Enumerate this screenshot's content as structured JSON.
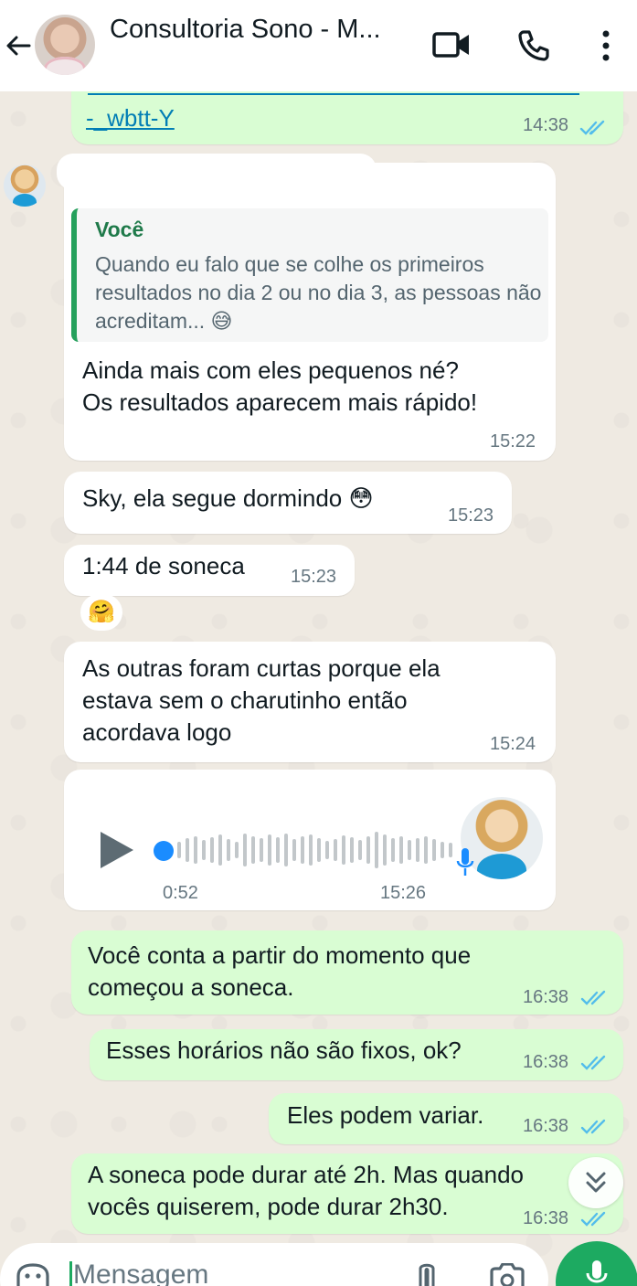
{
  "header": {
    "title": "Consultoria Sono - M...",
    "icons": [
      "back-arrow-icon",
      "video-call-icon",
      "phone-icon",
      "more-vert-icon"
    ]
  },
  "messages": {
    "link_msg": {
      "text": "-_wbtt-Y",
      "time": "14:38"
    },
    "reply_msg": {
      "quote_author": "Você",
      "quote_text": "Quando eu falo que se colhe os primeiros resultados no dia 2 ou no dia 3, as pessoas não acreditam... 😅",
      "line1": "Ainda mais com eles pequenos né?",
      "line2": "Os resultados aparecem mais rápido!",
      "time": "15:22"
    },
    "msg_sky": {
      "text": "Sky, ela segue dormindo 😳",
      "time": "15:23"
    },
    "msg_soneca": {
      "text": "1:44 de soneca",
      "time": "15:23"
    },
    "reaction": "🤗",
    "msg_outras": {
      "line1": "As outras foram curtas porque ela",
      "line2": "estava sem o charutinho então",
      "line3": "acordava logo",
      "time": "15:24"
    },
    "voice": {
      "duration": "0:52",
      "time": "15:26",
      "progress": 0
    },
    "out1": {
      "line1": "Você conta a partir do momento que",
      "line2": "começou a soneca.",
      "time": "16:38"
    },
    "out2": {
      "text": "Esses horários não são fixos, ok?",
      "time": "16:38"
    },
    "out3": {
      "text": "Eles podem variar.",
      "time": "16:38"
    },
    "out4": {
      "line1": "A soneca pode durar até 2h. Mas quando",
      "line2": "vocês quiserem, pode durar 2h30.",
      "time": "16:38"
    }
  },
  "input": {
    "placeholder": "Mensagem"
  },
  "colors": {
    "accent": "#1daa61",
    "outgoing": "#d9fdd3",
    "tick_blue": "#53bdeb"
  }
}
